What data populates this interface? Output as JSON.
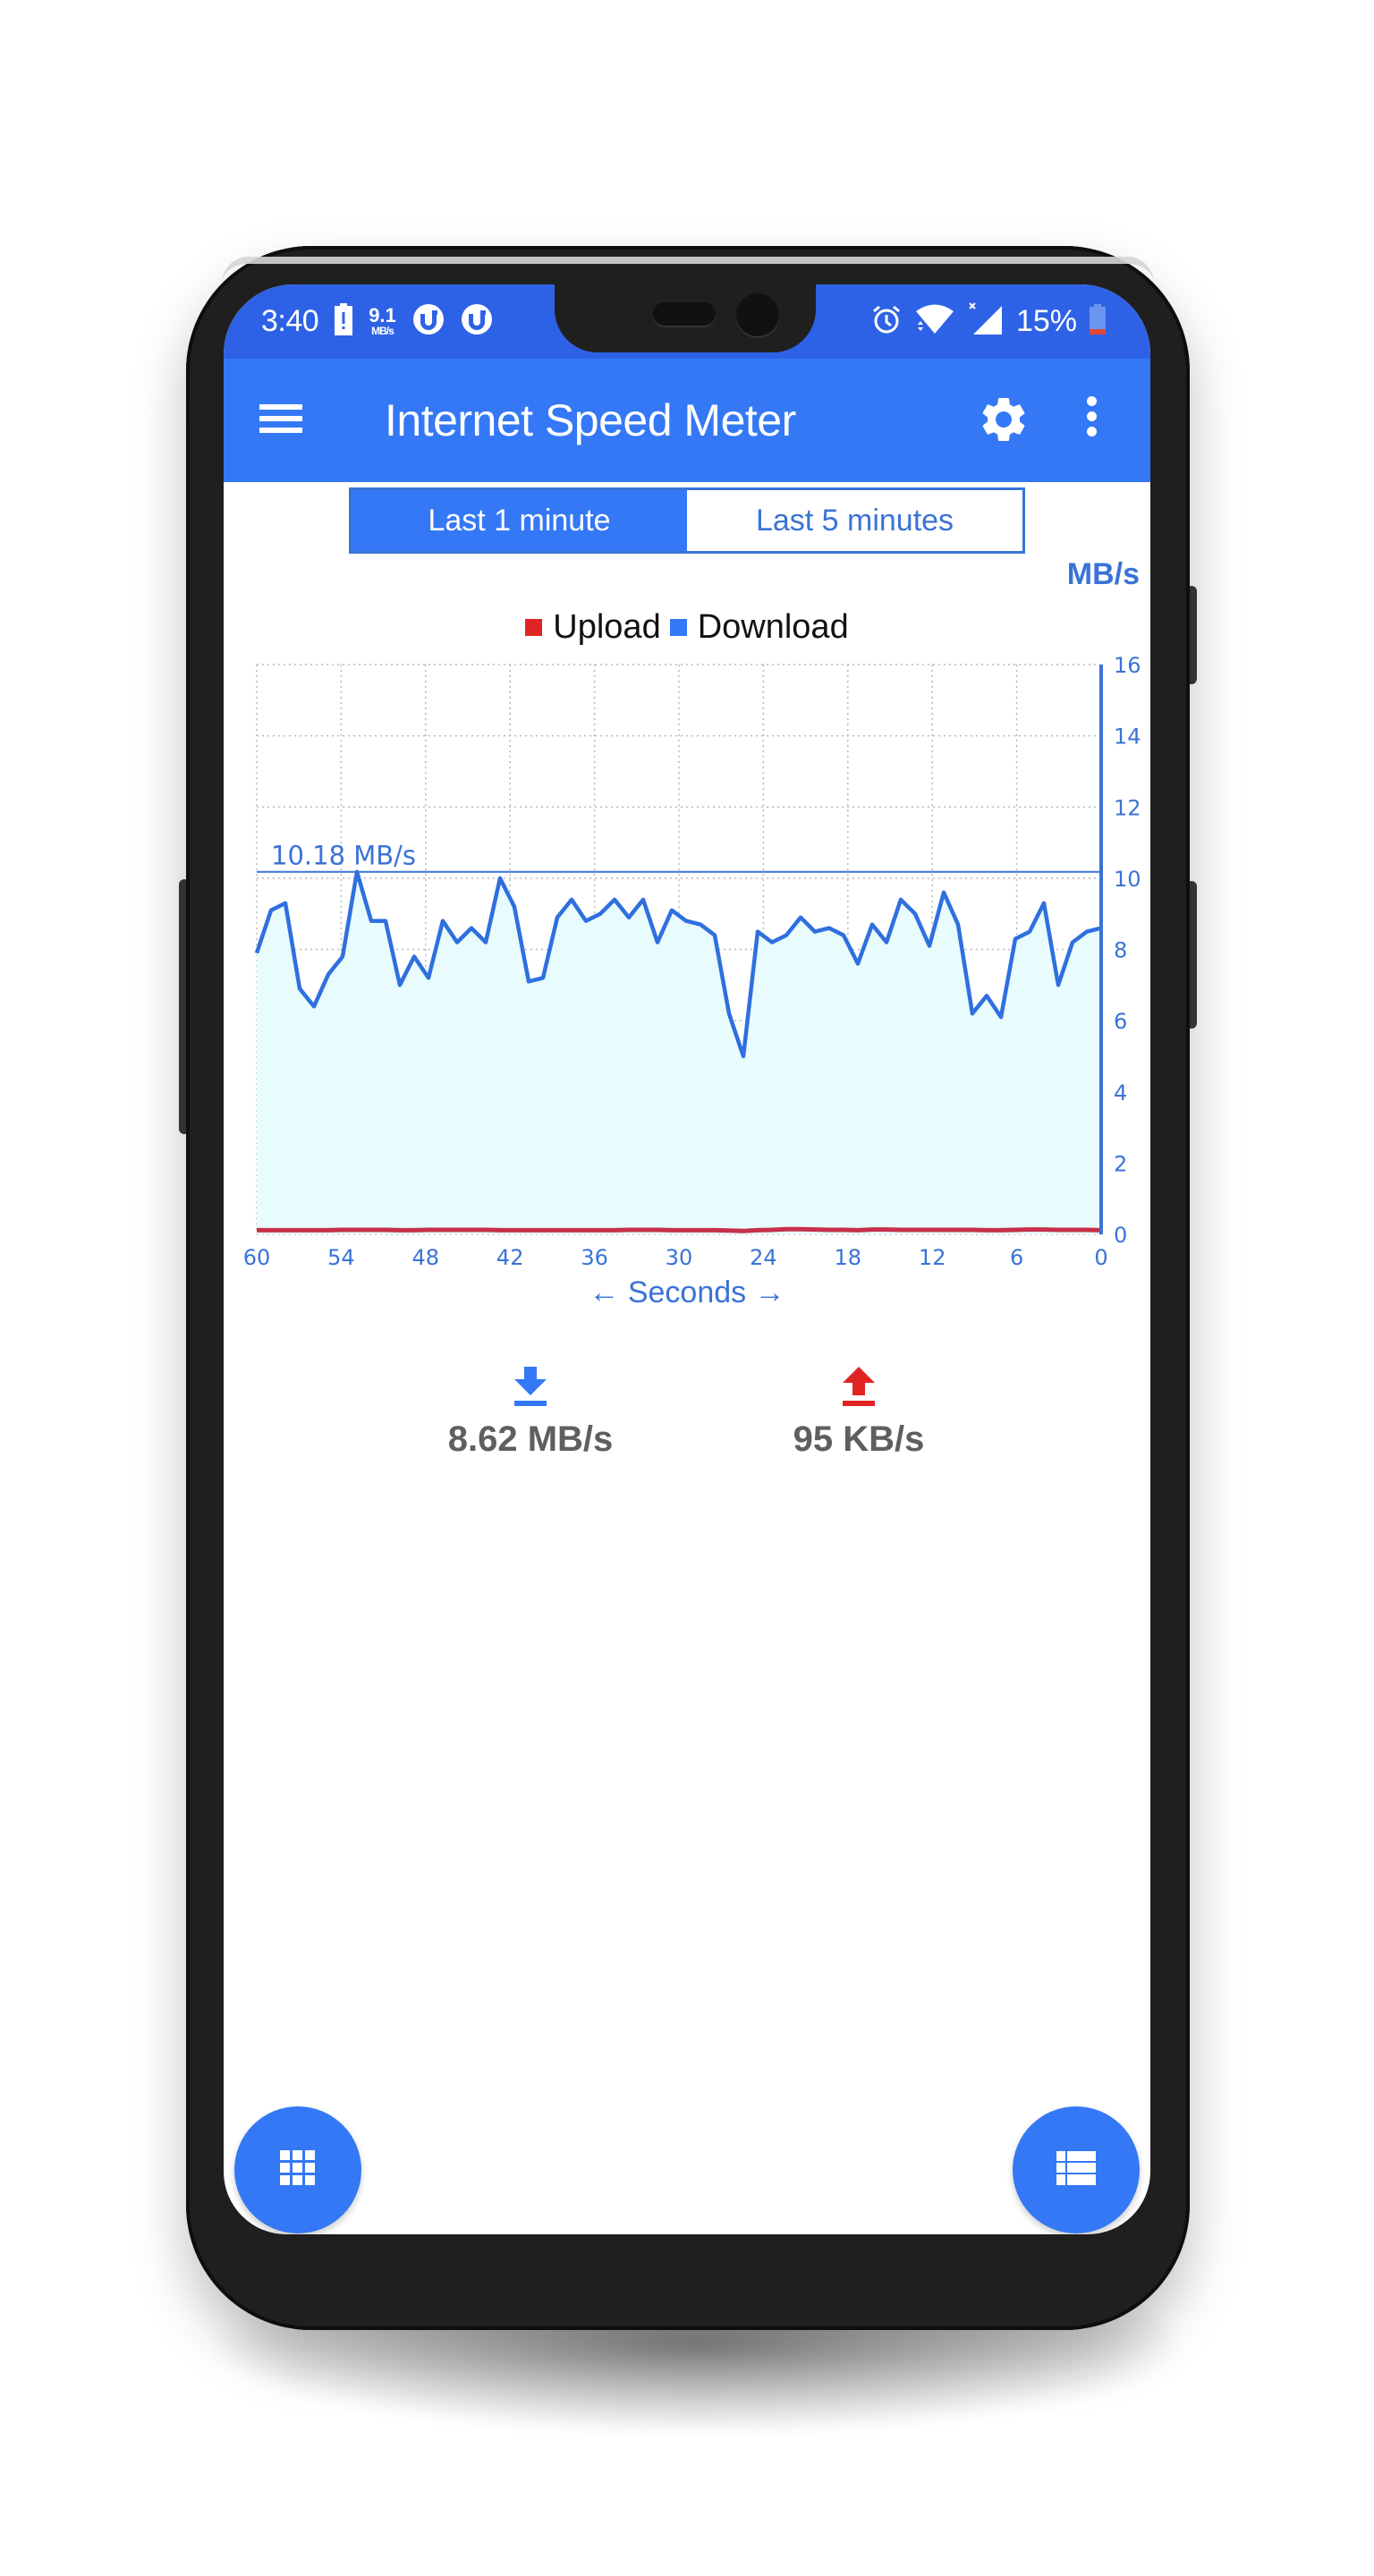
{
  "status_bar": {
    "time": "3:40",
    "net_speed_value": "9.1",
    "net_speed_unit": "MB/s",
    "battery_percent": "15%",
    "icons_left": [
      "battery-alert-icon",
      "net-speed-indicator",
      "utorrent-icon",
      "utorrent-icon"
    ],
    "icons_right": [
      "alarm-icon",
      "wifi-icon",
      "signal-no-data-icon",
      "battery-low-icon"
    ]
  },
  "app_bar": {
    "title": "Internet Speed Meter",
    "menu_icon": "hamburger-menu-icon",
    "settings_icon": "gear-icon",
    "overflow_icon": "more-vert-icon"
  },
  "range_toggle": {
    "options": [
      "Last 1 minute",
      "Last 5 minutes"
    ],
    "selected": "Last 1 minute"
  },
  "colors": {
    "primary": "#3478f6",
    "status_bar": "#2e62e6",
    "download": "#3478f6",
    "upload": "#e02424",
    "area_fill": "#e8fbfd",
    "axis": "#3a73d6",
    "readout_text": "#5f5f5f"
  },
  "chart_data": {
    "type": "line",
    "title": "",
    "unit_label": "MB/s",
    "xlabel": "← Seconds →",
    "ylabel": "MB/s",
    "x_tick_labels": [
      "60",
      "54",
      "48",
      "42",
      "36",
      "30",
      "24",
      "18",
      "12",
      "6",
      "0"
    ],
    "y_tick_labels": [
      "0",
      "2",
      "4",
      "6",
      "8",
      "10",
      "12",
      "14",
      "16"
    ],
    "xlim": [
      60,
      0
    ],
    "ylim": [
      0,
      16
    ],
    "grid": true,
    "legend": {
      "position": "top-center",
      "entries": [
        "Upload",
        "Download"
      ]
    },
    "peak_annotation": {
      "value": 10.18,
      "label": "10.18 MB/s"
    },
    "series": [
      {
        "name": "Upload",
        "color": "#e02424",
        "values": [
          0.09,
          0.09,
          0.09,
          0.09,
          0.09,
          0.09,
          0.1,
          0.1,
          0.1,
          0.1,
          0.09,
          0.09,
          0.1,
          0.1,
          0.1,
          0.1,
          0.1,
          0.09,
          0.09,
          0.09,
          0.09,
          0.09,
          0.09,
          0.09,
          0.09,
          0.09,
          0.1,
          0.1,
          0.1,
          0.09,
          0.09,
          0.09,
          0.09,
          0.08,
          0.07,
          0.09,
          0.1,
          0.12,
          0.12,
          0.11,
          0.1,
          0.1,
          0.09,
          0.11,
          0.11,
          0.1,
          0.1,
          0.1,
          0.1,
          0.1,
          0.1,
          0.09,
          0.09,
          0.1,
          0.11,
          0.11,
          0.1,
          0.1,
          0.1,
          0.09
        ]
      },
      {
        "name": "Download",
        "color": "#3478f6",
        "values": [
          7.9,
          9.1,
          9.3,
          6.9,
          6.4,
          7.3,
          7.8,
          10.18,
          8.8,
          8.8,
          7.0,
          7.8,
          7.2,
          8.8,
          8.2,
          8.6,
          8.2,
          10.0,
          9.2,
          7.1,
          7.2,
          8.9,
          9.4,
          8.8,
          9.0,
          9.4,
          8.9,
          9.4,
          8.2,
          9.1,
          8.8,
          8.7,
          8.4,
          6.2,
          5.0,
          8.5,
          8.2,
          8.4,
          8.9,
          8.5,
          8.6,
          8.4,
          7.6,
          8.7,
          8.2,
          9.4,
          9.0,
          8.1,
          9.6,
          8.7,
          6.2,
          6.7,
          6.1,
          8.3,
          8.5,
          9.3,
          7.0,
          8.2,
          8.5,
          8.6
        ]
      }
    ]
  },
  "readouts": {
    "download": {
      "icon": "download-arrow-icon",
      "value": "8.62 MB/s"
    },
    "upload": {
      "icon": "upload-arrow-icon",
      "value": "95 KB/s"
    }
  },
  "fabs": {
    "left_icon": "grid-apps-icon",
    "right_icon": "list-view-icon"
  }
}
